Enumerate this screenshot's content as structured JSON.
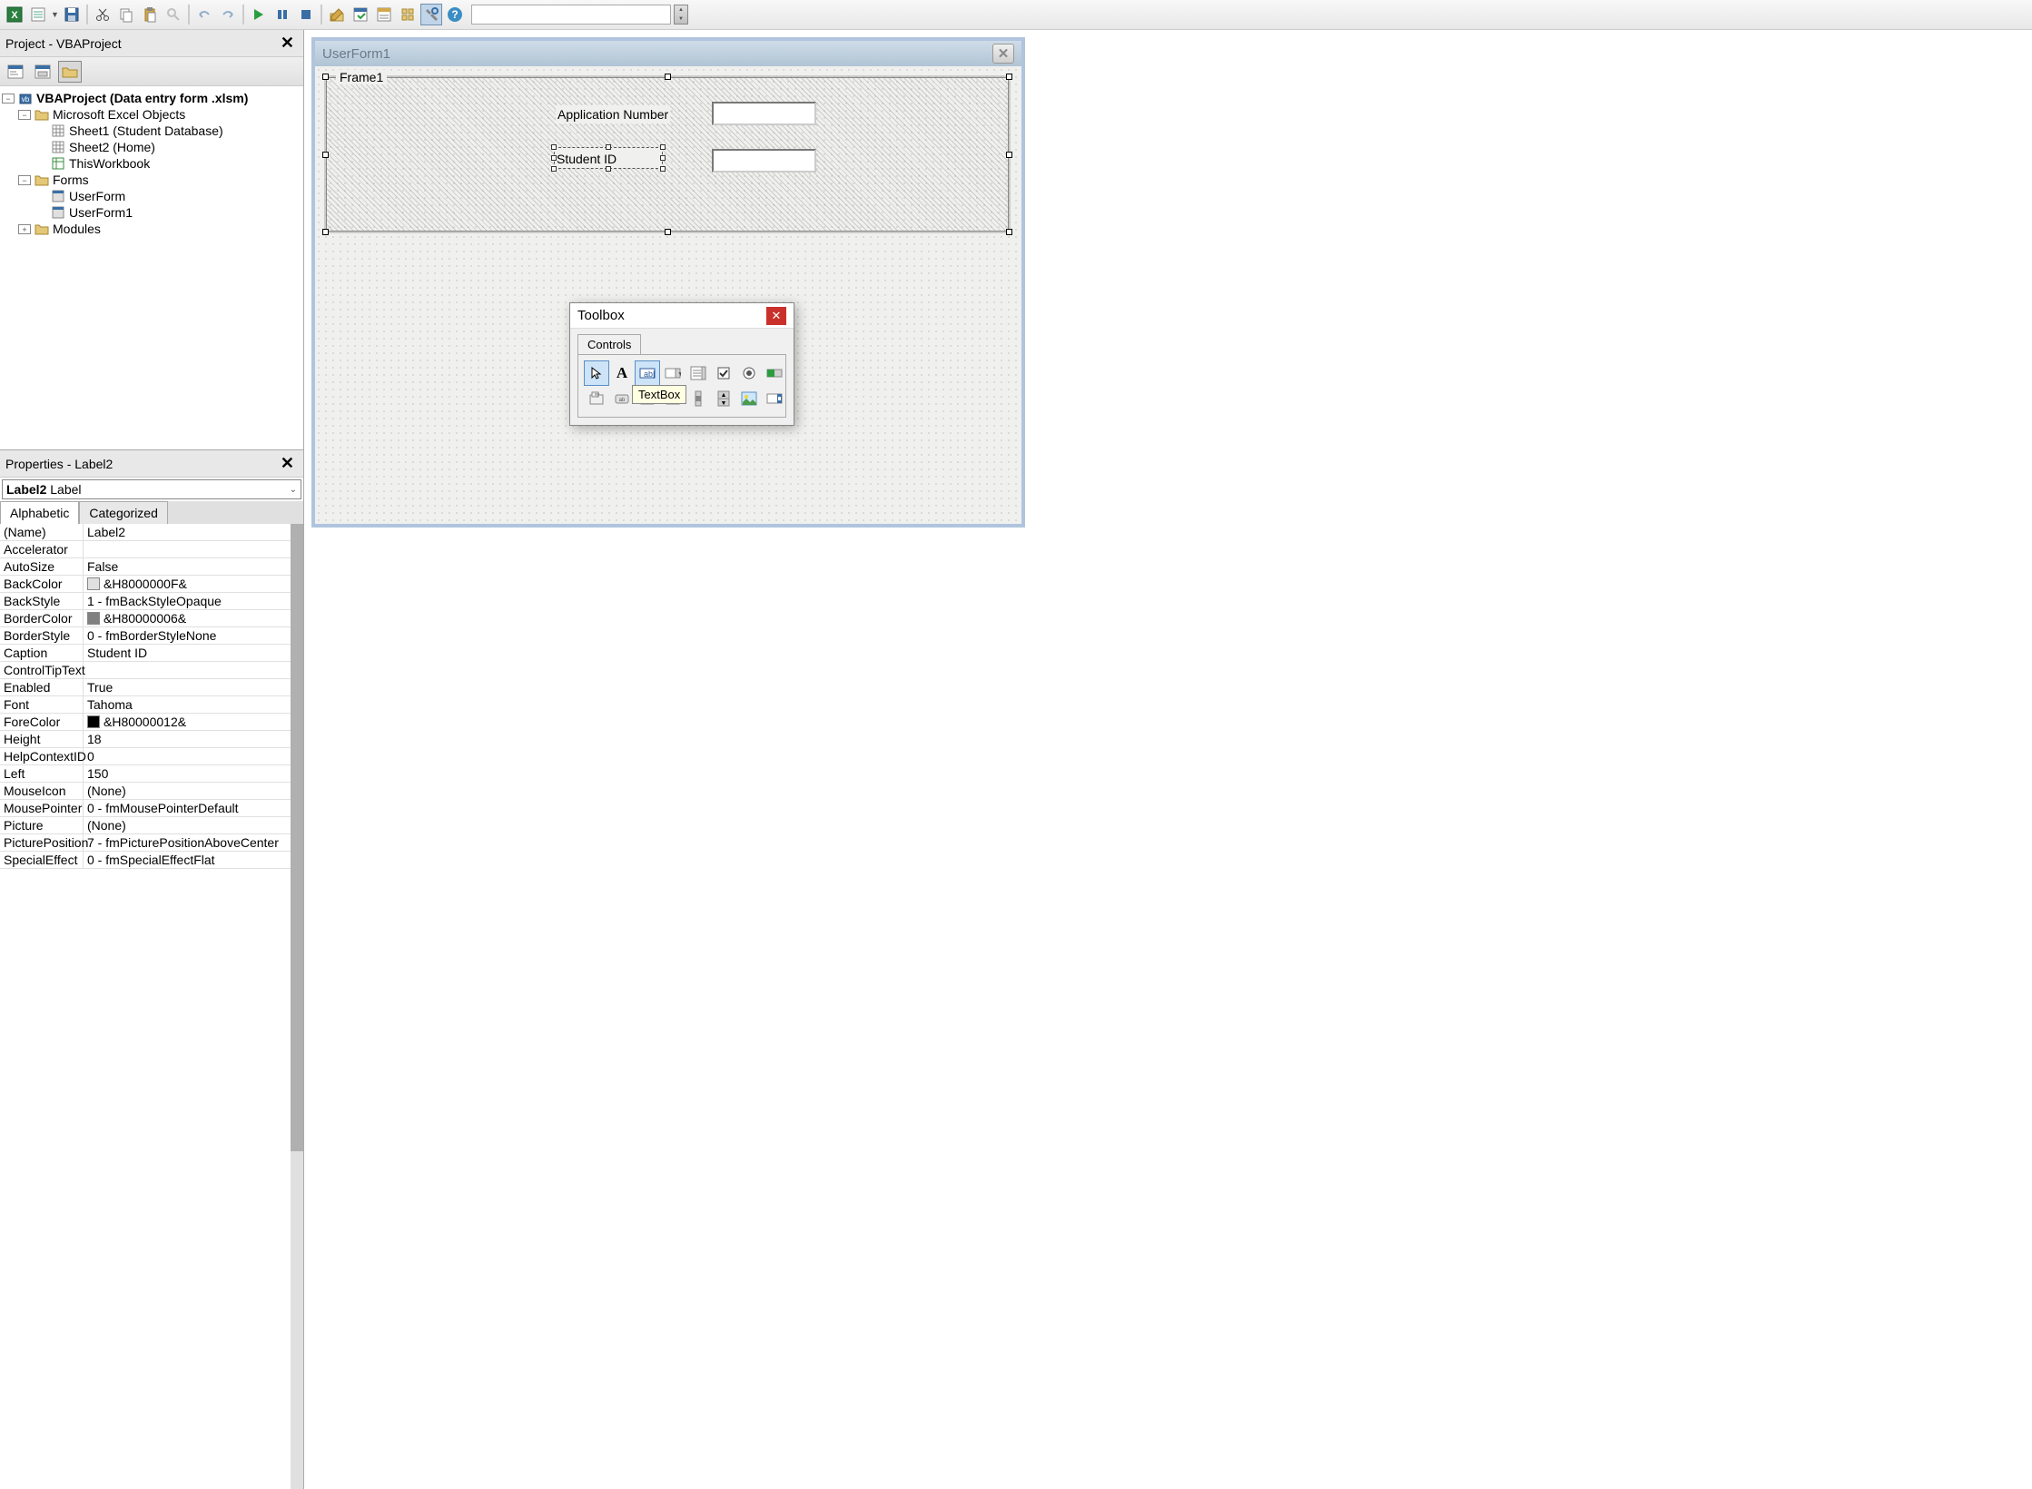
{
  "project_panel": {
    "title": "Project - VBAProject",
    "root": "VBAProject (Data entry form .xlsm)",
    "excel_objects": "Microsoft Excel Objects",
    "sheet1": "Sheet1 (Student Database)",
    "sheet2": "Sheet2 (Home)",
    "thisworkbook": "ThisWorkbook",
    "forms": "Forms",
    "userform": "UserForm",
    "userform1": "UserForm1",
    "modules": "Modules"
  },
  "properties_panel": {
    "title": "Properties - Label2",
    "object_name": "Label2",
    "object_type": "Label",
    "tabs": {
      "alpha": "Alphabetic",
      "cat": "Categorized"
    },
    "rows": [
      {
        "k": "(Name)",
        "v": "Label2"
      },
      {
        "k": "Accelerator",
        "v": ""
      },
      {
        "k": "AutoSize",
        "v": "False"
      },
      {
        "k": "BackColor",
        "v": "&H8000000F&",
        "swatch": "#e0e0e0"
      },
      {
        "k": "BackStyle",
        "v": "1 - fmBackStyleOpaque"
      },
      {
        "k": "BorderColor",
        "v": "&H80000006&",
        "swatch": "#808080"
      },
      {
        "k": "BorderStyle",
        "v": "0 - fmBorderStyleNone"
      },
      {
        "k": "Caption",
        "v": "Student ID"
      },
      {
        "k": "ControlTipText",
        "v": ""
      },
      {
        "k": "Enabled",
        "v": "True"
      },
      {
        "k": "Font",
        "v": "Tahoma"
      },
      {
        "k": "ForeColor",
        "v": "&H80000012&",
        "swatch": "#000000"
      },
      {
        "k": "Height",
        "v": "18"
      },
      {
        "k": "HelpContextID",
        "v": "0"
      },
      {
        "k": "Left",
        "v": "150"
      },
      {
        "k": "MouseIcon",
        "v": "(None)"
      },
      {
        "k": "MousePointer",
        "v": "0 - fmMousePointerDefault"
      },
      {
        "k": "Picture",
        "v": "(None)"
      },
      {
        "k": "PicturePosition",
        "v": "7 - fmPicturePositionAboveCenter"
      },
      {
        "k": "SpecialEffect",
        "v": "0 - fmSpecialEffectFlat"
      }
    ]
  },
  "designer": {
    "title": "UserForm1",
    "frame": "Frame1",
    "label1": "Application Number",
    "label2": "Student ID"
  },
  "toolbox": {
    "title": "Toolbox",
    "tab": "Controls",
    "tooltip": "TextBox"
  }
}
